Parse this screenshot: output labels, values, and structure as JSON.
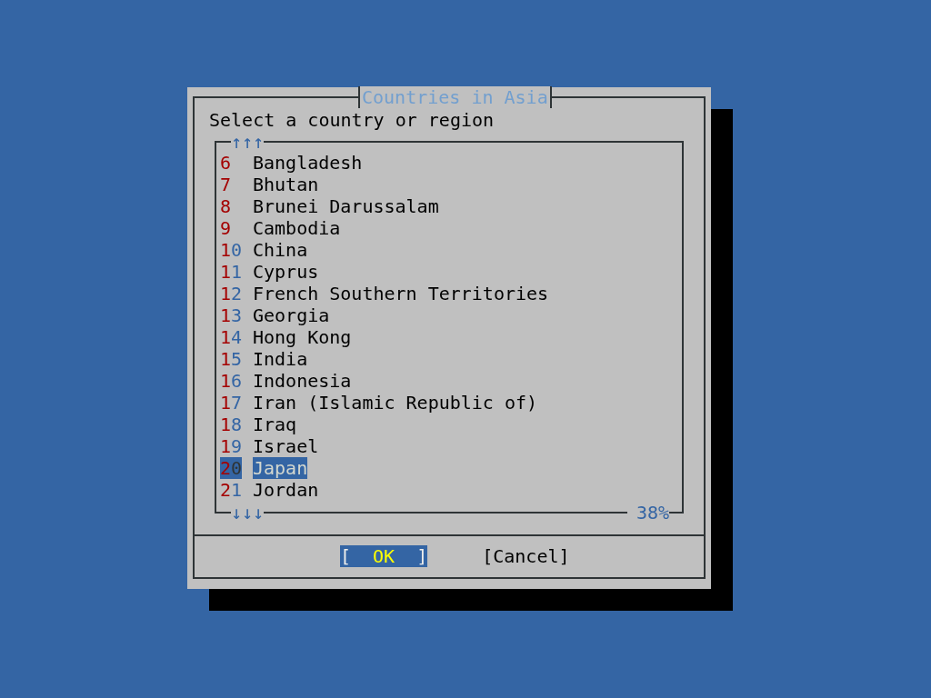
{
  "dialog": {
    "title": "Countries in Asia",
    "prompt": "Select a country or region",
    "list": {
      "scroll_up": "↑↑↑",
      "scroll_down": "↓↓↓",
      "percent": "38%",
      "items": [
        {
          "tag": "6",
          "name": "Bangladesh",
          "selected": false
        },
        {
          "tag": "7",
          "name": "Bhutan",
          "selected": false
        },
        {
          "tag": "8",
          "name": "Brunei Darussalam",
          "selected": false
        },
        {
          "tag": "9",
          "name": "Cambodia",
          "selected": false
        },
        {
          "tag": "10",
          "name": "China",
          "selected": false
        },
        {
          "tag": "11",
          "name": "Cyprus",
          "selected": false
        },
        {
          "tag": "12",
          "name": "French Southern Territories",
          "selected": false
        },
        {
          "tag": "13",
          "name": "Georgia",
          "selected": false
        },
        {
          "tag": "14",
          "name": "Hong Kong",
          "selected": false
        },
        {
          "tag": "15",
          "name": "India",
          "selected": false
        },
        {
          "tag": "16",
          "name": "Indonesia",
          "selected": false
        },
        {
          "tag": "17",
          "name": "Iran (Islamic Republic of)",
          "selected": false
        },
        {
          "tag": "18",
          "name": "Iraq",
          "selected": false
        },
        {
          "tag": "19",
          "name": "Israel",
          "selected": false
        },
        {
          "tag": "20",
          "name": "Japan",
          "selected": true
        },
        {
          "tag": "21",
          "name": "Jordan",
          "selected": false
        }
      ]
    },
    "buttons": [
      {
        "left": "[",
        "label": "OK",
        "right": "]",
        "selected": true
      },
      {
        "left": "[",
        "label": "Cancel",
        "right": "]",
        "selected": false
      }
    ]
  }
}
